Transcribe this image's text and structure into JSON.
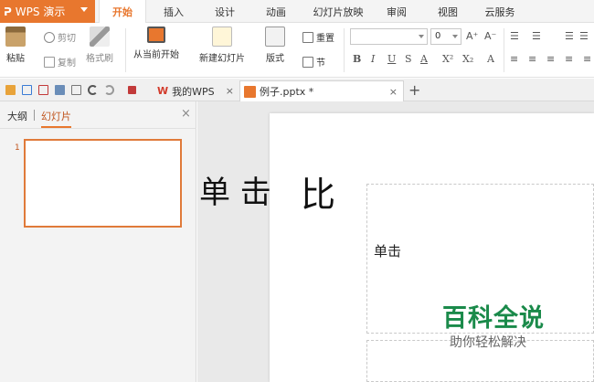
{
  "app": {
    "logo": "ᕈ",
    "title": "WPS 演示"
  },
  "menu_tabs": [
    "开始",
    "插入",
    "设计",
    "动画",
    "幻灯片放映",
    "审阅",
    "视图",
    "云服务"
  ],
  "ribbon": {
    "paste": "粘贴",
    "cut": "剪切",
    "copy": "复制",
    "format_painter": "格式刷",
    "from_current": "从当前开始",
    "new_slide": "新建幻灯片",
    "layout": "版式",
    "reset": "重置",
    "section": "节",
    "font_size": "0",
    "bold": "B",
    "italic": "I",
    "underline": "U",
    "strike": "S",
    "font_color": "A",
    "superscript": "X²",
    "subscript": "X₂",
    "grow": "A⁺",
    "shrink": "A⁻",
    "clear": "A"
  },
  "doc_tabs": [
    {
      "label": "我的WPS",
      "close": "×"
    },
    {
      "label": "例子.pptx *",
      "close": "×"
    }
  ],
  "new_tab": "+",
  "left_panel": {
    "tabs": [
      "大纲",
      "幻灯片"
    ],
    "close": "×",
    "slide_number": "1"
  },
  "slide": {
    "title_fragment": "单 击",
    "title_right": "比",
    "subtitle_fragment": "单击"
  },
  "watermark": {
    "main": "百科全说",
    "sub": "助你轻松解决"
  },
  "colors": {
    "accent": "#e8772e",
    "watermark": "#1a8a4a"
  }
}
